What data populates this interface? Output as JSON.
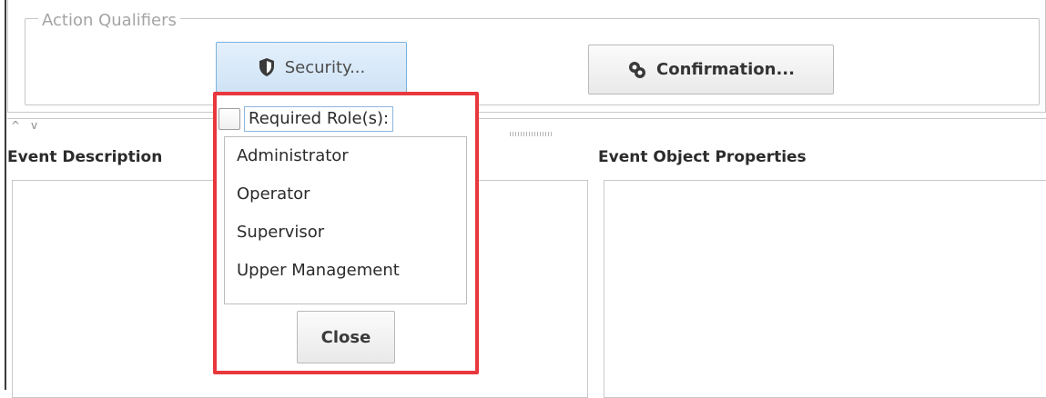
{
  "qualifiers": {
    "title": "Action Qualifiers",
    "security_label": "Security...",
    "confirmation_label": "Confirmation..."
  },
  "panels": {
    "event_description": "Event Description",
    "event_object_properties": "Event Object Properties"
  },
  "security_popup": {
    "required_roles_label": "Required Role(s):",
    "required_roles_checked": false,
    "roles": [
      "Administrator",
      "Operator",
      "Supervisor",
      "Upper Management"
    ],
    "close_label": "Close"
  },
  "splitter": {
    "up_glyph": "^",
    "down_glyph": "v"
  },
  "colors": {
    "highlight": "#e8383d",
    "accent": "#7ab3e0"
  },
  "icons": {
    "security": "shield-icon",
    "confirmation": "link-icon"
  }
}
